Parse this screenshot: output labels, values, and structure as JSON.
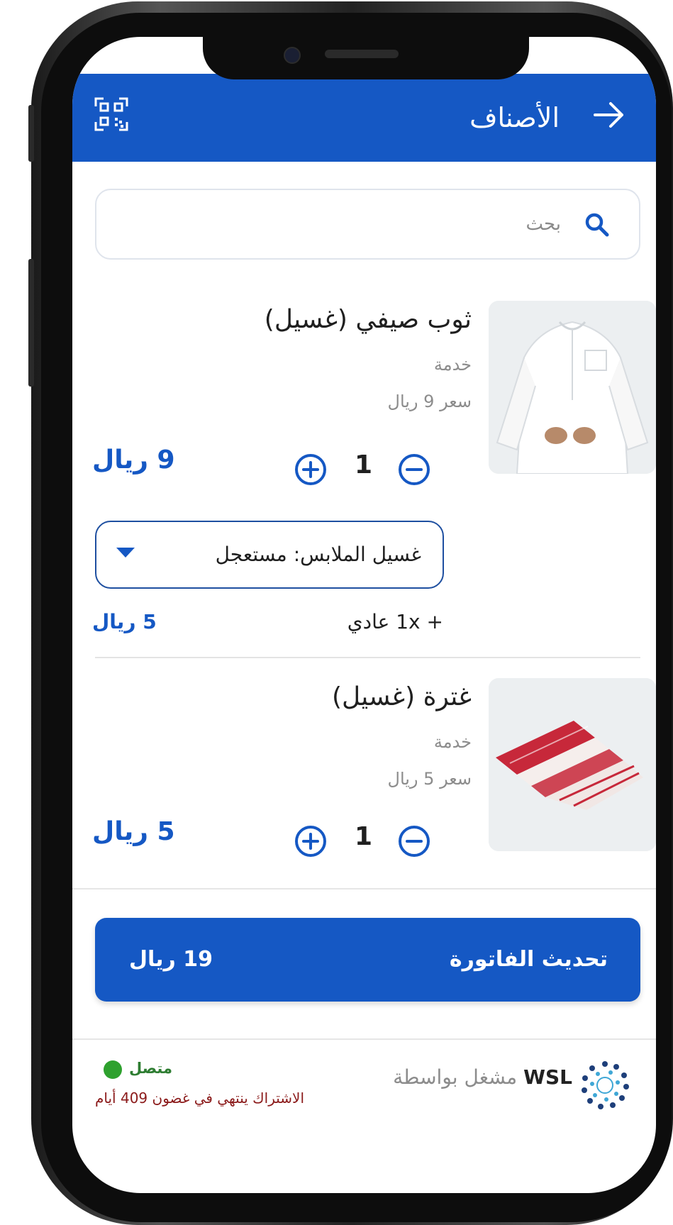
{
  "header": {
    "title": "الأصناف",
    "back_icon": "arrow-right-icon",
    "qr_icon": "qr-scan-icon",
    "color": "#1558c4"
  },
  "search": {
    "placeholder": "بحث",
    "icon": "search-icon"
  },
  "items": [
    {
      "name": "ثوب صيفي (غسيل)",
      "type": "خدمة",
      "unit_price": "سعر 9 ريال",
      "quantity": "1",
      "total": "9 ريال"
    },
    {
      "name": "غترة (غسيل)",
      "type": "خدمة",
      "unit_price": "سعر 5 ريال",
      "quantity": "1",
      "total": "5 ريال"
    }
  ],
  "addon": {
    "select_value": "غسيل الملابس: مستعجل",
    "line": "+ 1x عادي",
    "price": "5 ريال"
  },
  "invoice": {
    "label": "تحديث الفاتورة",
    "total": "19 ريال"
  },
  "footer": {
    "status": "متصل",
    "subscription": "الاشتراك ينتهي في غضون 409 أيام",
    "powered_by": "مشغل بواسطة",
    "brand": "WSL",
    "status_color": "#2ea12e"
  }
}
